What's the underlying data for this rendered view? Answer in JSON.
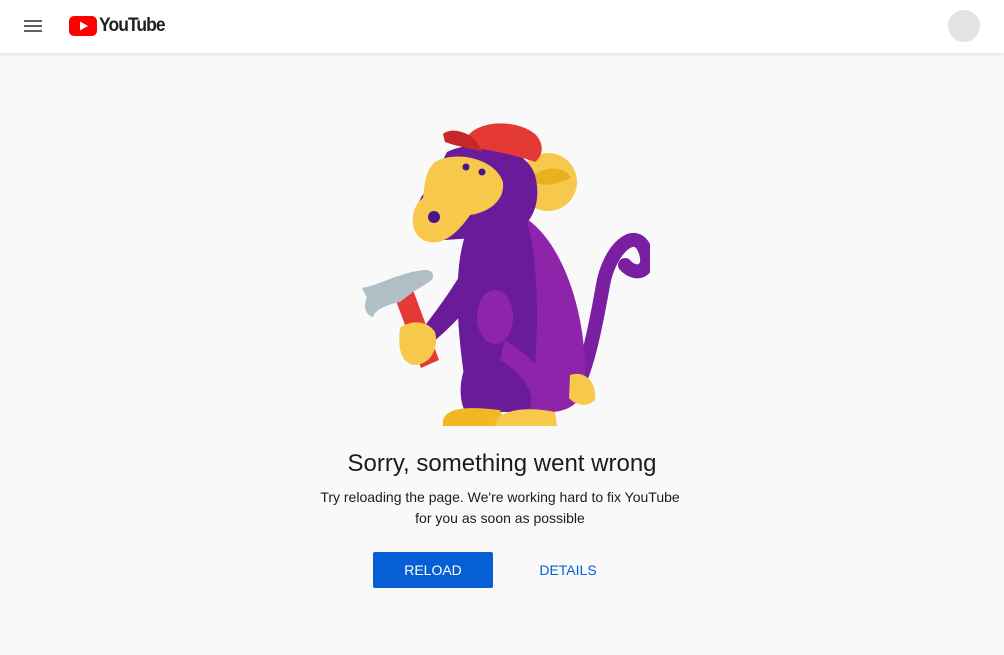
{
  "header": {
    "logo_text": "YouTube",
    "menu_icon": "hamburger-menu-icon",
    "logo_icon": "youtube-play-icon",
    "avatar_icon": "avatar-placeholder"
  },
  "error": {
    "illustration": "monkey-with-hammer",
    "headline": "Sorry, something went wrong",
    "message_line1": "Try reloading the page. We're working hard to fix YouTube",
    "message_line2": "for you as soon as possible"
  },
  "actions": {
    "reload_label": "Reload",
    "details_label": "Details"
  },
  "colors": {
    "brand_red": "#ff0000",
    "primary_blue": "#065fd4",
    "background": "#f9f9f9",
    "monkey_purple": "#6a1b9a",
    "monkey_face": "#f6c94c"
  }
}
